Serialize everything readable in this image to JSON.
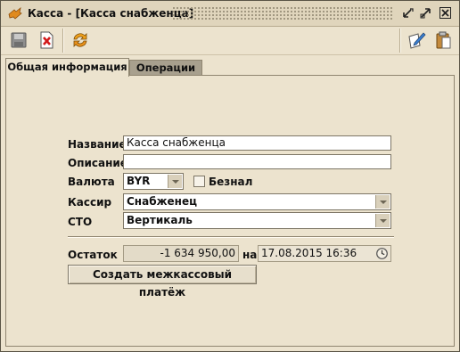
{
  "window": {
    "title": "Касса - [Касса снабженца]"
  },
  "tabs": [
    {
      "label": "Общая информация",
      "active": true
    },
    {
      "label": "Операции",
      "active": false
    }
  ],
  "form": {
    "name_label": "Название",
    "name_value": "Касса снабженца",
    "description_label": "Описание",
    "description_value": "",
    "currency_label": "Валюта",
    "currency_value": "BYR",
    "cashless_label": "Безнал",
    "cashless_checked": false,
    "cashier_label": "Кассир",
    "cashier_value": "Снабженец",
    "sto_label": "СТО",
    "sto_value": "Вертикаль",
    "balance_label": "Остаток",
    "balance_value": "-1 634 950,00",
    "on_label": "на",
    "date_value": "17.08.2015 16:36",
    "transfer_button": "Создать межкассовый платёж"
  }
}
